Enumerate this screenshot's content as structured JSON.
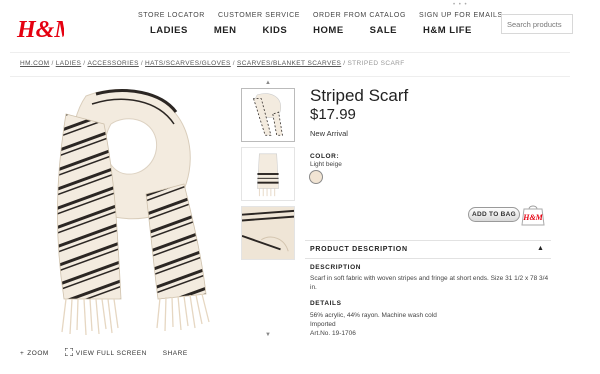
{
  "brand": {
    "logo_text": "H&M",
    "color": "#e50010"
  },
  "utility_nav": [
    "STORE LOCATOR",
    "CUSTOMER SERVICE",
    "ORDER FROM CATALOG",
    "SIGN UP FOR EMAILS"
  ],
  "main_nav": [
    "LADIES",
    "MEN",
    "KIDS",
    "HOME",
    "SALE",
    "H&M LIFE"
  ],
  "search": {
    "placeholder": "Search products",
    "value": ""
  },
  "breadcrumb": {
    "links": [
      "HM.COM",
      "LADIES",
      "ACCESSORIES",
      "HATS/SCARVES/GLOVES",
      "SCARVES/BLANKET SCARVES"
    ],
    "separator": "/",
    "current": "STRIPED SCARF"
  },
  "image_tools": {
    "zoom": "ZOOM",
    "view_full": "VIEW FULL SCREEN",
    "share": "SHARE"
  },
  "product": {
    "title": "Striped Scarf",
    "price": "$17.99",
    "badge": "New Arrival",
    "color_label": "COLOR:",
    "color_value": "Light beige",
    "swatch_color": "#f1e4d3",
    "add_to_bag": "ADD TO BAG",
    "bag_logo": "H&M"
  },
  "description": {
    "header": "PRODUCT DESCRIPTION",
    "toggle": "▲",
    "desc_label": "DESCRIPTION",
    "desc_text": "Scarf in soft fabric with woven stripes and fringe at short ends. Size 31 1/2 x 78 3/4 in.",
    "details_label": "DETAILS",
    "details_lines": [
      "56% acrylic, 44% rayon. Machine wash cold",
      "Imported",
      "Art.No. 19-1706"
    ]
  },
  "icons": {
    "zoom": "plus-icon",
    "full_screen": "expand-icon",
    "scroll_up": "chevron-up-icon",
    "scroll_down": "chevron-down-icon"
  }
}
